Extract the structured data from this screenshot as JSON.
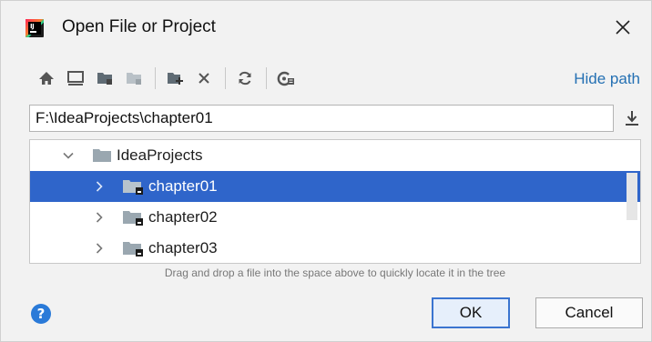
{
  "window": {
    "title": "Open File or Project"
  },
  "toolbar": {
    "buttons": [
      {
        "icon": "home-icon"
      },
      {
        "icon": "desktop-icon"
      },
      {
        "icon": "project-folder-icon"
      },
      {
        "icon": "module-folder-icon"
      },
      {
        "icon": "new-folder-icon"
      },
      {
        "icon": "delete-icon"
      },
      {
        "icon": "refresh-icon"
      },
      {
        "icon": "show-hidden-icon"
      }
    ],
    "hide_path_label": "Hide path"
  },
  "path": {
    "value": "F:\\IdeaProjects\\chapter01"
  },
  "tree": {
    "items": [
      {
        "label": "IdeaProjects",
        "expanded": true,
        "selected": false
      },
      {
        "label": "chapter01",
        "expanded": false,
        "selected": true
      },
      {
        "label": "chapter02",
        "expanded": false,
        "selected": false
      },
      {
        "label": "chapter03",
        "expanded": false,
        "selected": false
      }
    ]
  },
  "hint": "Drag and drop a file into the space above to quickly locate it in the tree",
  "footer": {
    "help_label": "?",
    "ok_label": "OK",
    "cancel_label": "Cancel"
  },
  "colors": {
    "selection": "#2f65ca",
    "link": "#2470b3",
    "help": "#2a7ad8",
    "folder": "#9aa7b0"
  }
}
